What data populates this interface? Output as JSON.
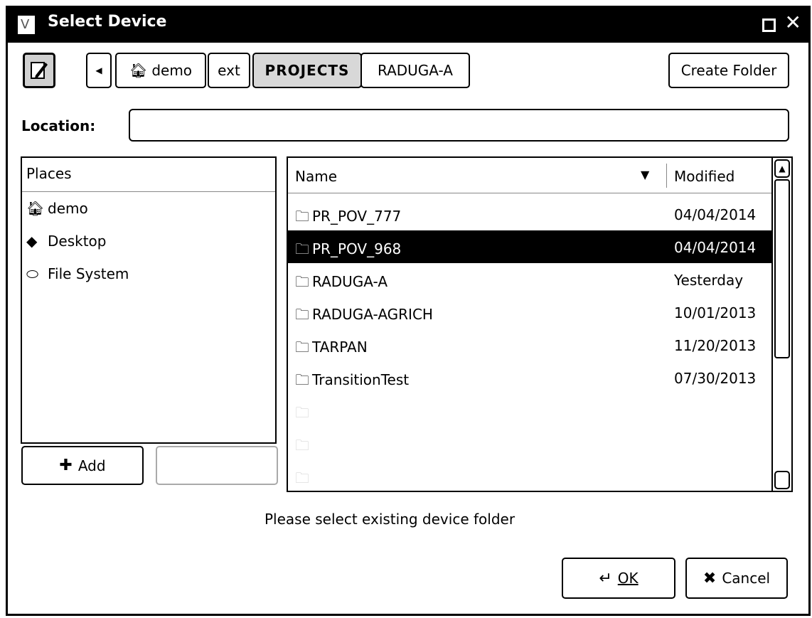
{
  "window": {
    "title": "Select Device",
    "app_icon": "V"
  },
  "toolbar": {
    "crumbs": [
      "demo",
      "ext",
      "PROJECTS",
      "RADUGA-A"
    ],
    "create_folder_label": "Create Folder"
  },
  "location": {
    "label": "Location:",
    "value": ""
  },
  "places": {
    "header": "Places",
    "items": [
      {
        "label": "demo",
        "icon": "home-icon"
      },
      {
        "label": "Desktop",
        "icon": "desktop-icon"
      },
      {
        "label": "File System",
        "icon": "drive-icon"
      }
    ],
    "add_label": "Add",
    "remove_label": ""
  },
  "files": {
    "name_header": "Name",
    "modified_header": "Modified",
    "rows": [
      {
        "name": "PR_POV_777",
        "modified": "04/04/2014"
      },
      {
        "name": "PR_POV_968",
        "modified": "04/04/2014"
      },
      {
        "name": "RADUGA-A",
        "modified": "Yesterday"
      },
      {
        "name": "RADUGA-AGRICH",
        "modified": "10/01/2013"
      },
      {
        "name": "TARPAN",
        "modified": "11/20/2013"
      },
      {
        "name": "TransitionTest",
        "modified": "07/30/2013"
      }
    ],
    "selected_index": 1
  },
  "status": {
    "text": "Please select existing device folder"
  },
  "actions": {
    "ok_label": "OK",
    "cancel_label": "Cancel"
  }
}
